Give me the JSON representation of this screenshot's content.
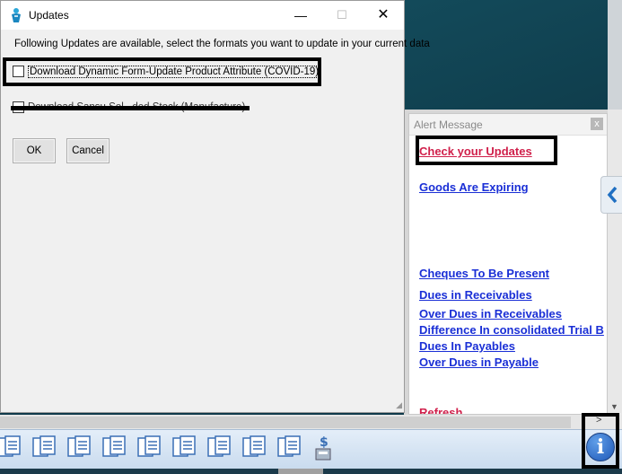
{
  "dialog": {
    "title": "Updates",
    "intro": "Following Updates are available, select the formats you want to update in your current data",
    "option_1": "Download Dynamic Form-Update Product Attribute (COVID-19)",
    "option_2": "Download Sansu Sol...ded Stock (Manufacture)",
    "ok_label": "OK",
    "cancel_label": "Cancel",
    "min_glyph": "—",
    "max_glyph": "☐",
    "close_glyph": "✕"
  },
  "alert": {
    "title": "Alert Message",
    "close_glyph": "x",
    "check_updates": "Check your Updates",
    "goods_expiring": "Goods Are Expiring",
    "cheques": "Cheques To Be Present",
    "dues_receivables": "Dues in Receivables",
    "over_dues_receivables": "Over Dues in Receivables",
    "difference_trial": "Difference In consolidated Trial B",
    "dues_payables": "Dues In Payables",
    "over_dues_payable": "Over Dues in Payable",
    "refresh": "Refresh"
  },
  "toolbar": {
    "info_glyph": "i",
    "hscroll_arrow": ">",
    "doc_buttons": [
      "document-copy-icon",
      "document-copy-icon",
      "document-copy-icon",
      "document-copy-icon",
      "document-copy-icon",
      "document-copy-icon",
      "document-copy-icon",
      "document-copy-icon",
      "document-copy-icon"
    ],
    "currency_button": "dollar-doc-icon"
  },
  "colors": {
    "link_blue": "#1a2fd6",
    "link_red": "#d0204b",
    "dialog_bg": "#f0f0f0",
    "toolbar_bg": "#c9dbee"
  }
}
